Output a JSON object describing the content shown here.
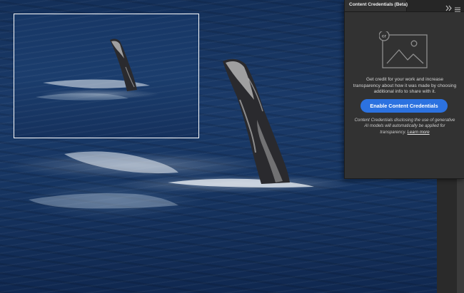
{
  "panel": {
    "title": "Content Credentials (Beta)",
    "description": "Get credit for your work and increase transparency about how it was made by choosing additional info to share with it.",
    "enable_button_label": "Enable Content Credentials",
    "note": "Content Credentials disclosing the use of generative AI models will automatically be applied for transparency.",
    "learn_more_label": "Learn more",
    "illustration_badge": "cr",
    "button_color": "#2c72e0"
  },
  "icons": {
    "collapse": "double-chevron-right-icon",
    "menu": "panel-menu-icon",
    "illustration": "content-credentials-image-icon"
  }
}
